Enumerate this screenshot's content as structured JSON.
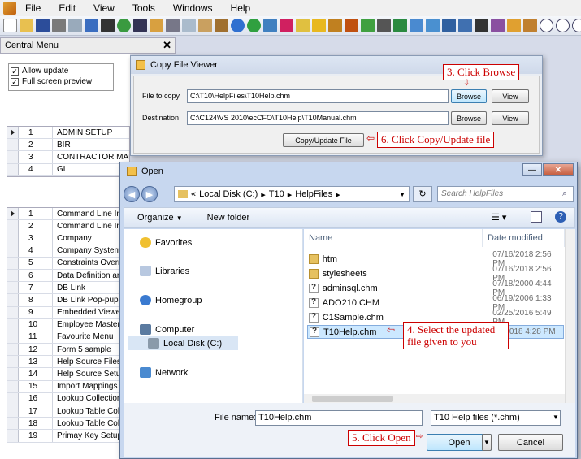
{
  "menubar": {
    "items": [
      "File",
      "Edit",
      "View",
      "Tools",
      "Windows",
      "Help"
    ]
  },
  "left_panel": {
    "title": "Central Menu",
    "options": [
      "Allow update",
      "Full screen preview"
    ],
    "top_grid": [
      {
        "n": "1",
        "name": "ADMIN SETUP"
      },
      {
        "n": "2",
        "name": "BIR"
      },
      {
        "n": "3",
        "name": "CONTRACTOR MANAGEMENT"
      },
      {
        "n": "4",
        "name": "GL"
      }
    ],
    "bottom_grid": [
      {
        "n": "1",
        "name": "Command Line Inte"
      },
      {
        "n": "2",
        "name": "Command Line Inte"
      },
      {
        "n": "3",
        "name": "Company"
      },
      {
        "n": "4",
        "name": "Company System F"
      },
      {
        "n": "5",
        "name": "Constraints Overrul"
      },
      {
        "n": "6",
        "name": "Data Definition and"
      },
      {
        "n": "7",
        "name": "DB Link"
      },
      {
        "n": "8",
        "name": "DB Link Pop-pup"
      },
      {
        "n": "9",
        "name": "Embedded Viewer"
      },
      {
        "n": "10",
        "name": "Employee Master F"
      },
      {
        "n": "11",
        "name": "Favourite Menu"
      },
      {
        "n": "12",
        "name": "Form 5 sample"
      },
      {
        "n": "13",
        "name": "Help Source Files"
      },
      {
        "n": "14",
        "name": "Help Source Setup"
      },
      {
        "n": "15",
        "name": "Import Mappings"
      },
      {
        "n": "16",
        "name": "Lookup Collection"
      },
      {
        "n": "17",
        "name": "Lookup Table Colle"
      },
      {
        "n": "18",
        "name": "Lookup Table Colle"
      },
      {
        "n": "19",
        "name": "Primay Key Setup"
      }
    ]
  },
  "copy_viewer": {
    "title": "Copy File Viewer",
    "file_to_copy_label": "File to copy",
    "file_to_copy_value": "C:\\T10\\HelpFiles\\T10Help.chm",
    "destination_label": "Destination",
    "destination_value": "C:\\C124\\VS 2010\\ecCFO\\T10Help\\T10Manual.chm",
    "browse_label": "Browse",
    "view_label": "View",
    "copy_update_label": "Copy/Update File"
  },
  "callouts": {
    "c3": "3. Click Browse",
    "c4": "4. Select the updated file given to you",
    "c5": "5. Click Open",
    "c6": "6. Click Copy/Update file"
  },
  "open_dialog": {
    "title": "Open",
    "address": [
      "Local Disk (C:)",
      "T10",
      "HelpFiles"
    ],
    "search_placeholder": "Search HelpFiles",
    "organize_label": "Organize",
    "new_folder_label": "New folder",
    "nav_items": [
      {
        "label": "Favorites",
        "icon": "star-icon"
      },
      {
        "label": "Libraries",
        "icon": "library-icon"
      },
      {
        "label": "Homegroup",
        "icon": "homegroup-icon"
      },
      {
        "label": "Computer",
        "icon": "computer-icon"
      },
      {
        "label": "Local Disk (C:)",
        "icon": "drive-icon"
      },
      {
        "label": "Network",
        "icon": "network-icon"
      }
    ],
    "columns": {
      "name": "Name",
      "date": "Date modified"
    },
    "files": [
      {
        "name": "htm",
        "date": "07/16/2018 2:56 PM",
        "type": "folder"
      },
      {
        "name": "stylesheets",
        "date": "07/16/2018 2:56 PM",
        "type": "folder"
      },
      {
        "name": "adminsql.chm",
        "date": "07/18/2000 4:44 PM",
        "type": "chm"
      },
      {
        "name": "ADO210.CHM",
        "date": "06/19/2006 1:33 PM",
        "type": "chm"
      },
      {
        "name": "C1Sample.chm",
        "date": "02/25/2016 5:49 PM",
        "type": "chm"
      },
      {
        "name": "T10Help.chm",
        "date": "5/2018 4:28 PM",
        "type": "chm",
        "selected": true
      }
    ],
    "filename_label": "File name:",
    "filename_value": "T10Help.chm",
    "filter_value": "T10 Help files (*.chm)",
    "open_label": "Open",
    "cancel_label": "Cancel"
  }
}
